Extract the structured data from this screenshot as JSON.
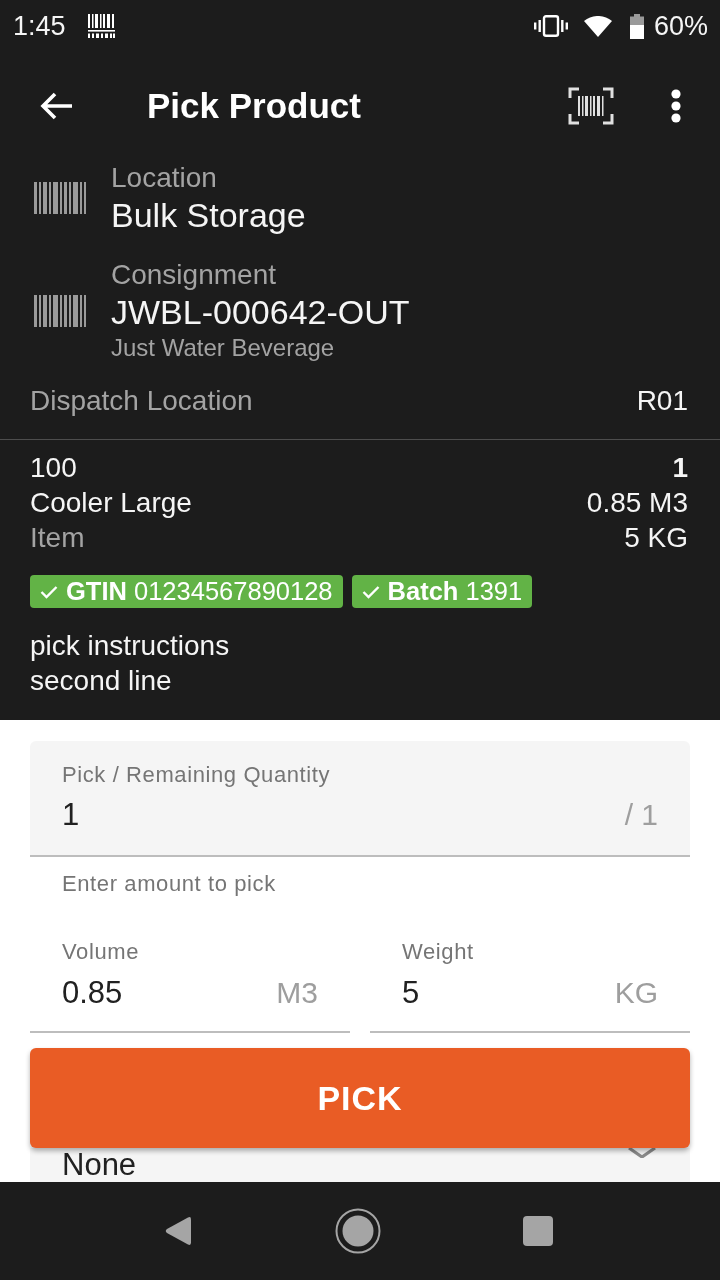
{
  "status_bar": {
    "time": "1:45",
    "battery": "60%"
  },
  "app_bar": {
    "title": "Pick Product"
  },
  "header": {
    "fields": [
      {
        "label": "Location",
        "value": "Bulk Storage"
      },
      {
        "label": "Consignment",
        "value": "JWBL-000642-OUT",
        "detail": "Just Water Beverage"
      }
    ],
    "dispatch": {
      "label": "Dispatch Location",
      "value": "R01"
    }
  },
  "item": {
    "code": "100",
    "name": "Cooler Large",
    "type": "Item",
    "quantity": "1",
    "volume": "0.85 M3",
    "weight": "5 KG",
    "badges": [
      {
        "text": "**GTIN** 01234567890128",
        "verified": true
      },
      {
        "text": "**Batch** 1391",
        "verified": true
      }
    ],
    "instructions": "pick instructions\nsecond line"
  },
  "form": {
    "quantity": {
      "label": "Pick / Remaining Quantity",
      "value": "1",
      "suffix": "/ 1",
      "helper": "Enter amount to pick"
    },
    "measures": [
      {
        "label": "Volume",
        "value": "0.85",
        "suffix": "M3"
      },
      {
        "label": "Weight",
        "value": "5",
        "suffix": "KG"
      }
    ],
    "pick_button": {
      "label": "PICK"
    },
    "select": {
      "value": "None"
    }
  }
}
